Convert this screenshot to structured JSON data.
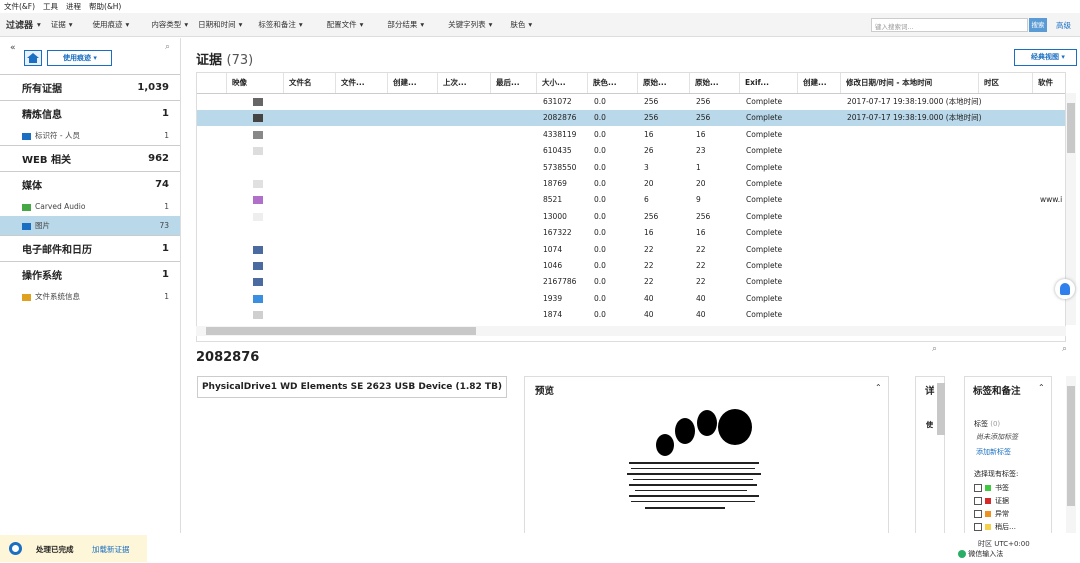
{
  "menubar": [
    "文件(&F)",
    "工具",
    "进程",
    "帮助(&H)"
  ],
  "filterbar": {
    "items": [
      "过滤器",
      "证据",
      "使用痕迹",
      "内容类型",
      "日期和时间",
      "标签和备注",
      "配置文件",
      "部分结果",
      "关键字列表",
      "肤色"
    ],
    "search_placeholder": "键入搜索词...",
    "search_button": "搜索",
    "advanced": "高级"
  },
  "sidebar": {
    "usage_dropdown": "使用痕迹",
    "categories": [
      {
        "label": "所有证据",
        "count": "1,039",
        "subs": []
      },
      {
        "label": "精炼信息",
        "count": "1",
        "subs": [
          {
            "label": "标识符 - 人员",
            "count": "1",
            "icon": "id-card-icon"
          }
        ]
      },
      {
        "label": "WEB 相关",
        "count": "962",
        "subs": []
      },
      {
        "label": "媒体",
        "count": "74",
        "subs": [
          {
            "label": "Carved Audio",
            "count": "1",
            "icon": "carved-audio-icon"
          },
          {
            "label": "图片",
            "count": "73",
            "icon": "picture-icon",
            "selected": true
          }
        ]
      },
      {
        "label": "电子邮件和日历",
        "count": "1",
        "subs": []
      },
      {
        "label": "操作系统",
        "count": "1",
        "subs": [
          {
            "label": "文件系统信息",
            "count": "1",
            "icon": "filesystem-icon"
          }
        ]
      }
    ]
  },
  "evidence": {
    "title": "证据",
    "count": "(73)",
    "view_button": "经典视图"
  },
  "grid": {
    "headers": [
      "",
      "映像",
      "文件名",
      "文件...",
      "创建...",
      "上次...",
      "最后...",
      "大小...",
      "肤色...",
      "原始...",
      "原始...",
      "Exif...",
      "创建...",
      "修改日期/时间 - 本地时间",
      "时区",
      "软件"
    ],
    "rows": [
      {
        "size": "631072",
        "skin": "0.0",
        "w": "256",
        "h": "256",
        "exif": "Complete",
        "modified": "2017-07-17 19:38:19.000  (本地时间)",
        "software": "",
        "thumb": "#666"
      },
      {
        "size": "2082876",
        "skin": "0.0",
        "w": "256",
        "h": "256",
        "exif": "Complete",
        "modified": "2017-07-17 19:38:19.000  (本地时间)",
        "software": "",
        "thumb": "#444",
        "selected": true
      },
      {
        "size": "4338119",
        "skin": "0.0",
        "w": "16",
        "h": "16",
        "exif": "Complete",
        "modified": "",
        "software": "",
        "thumb": "#888"
      },
      {
        "size": "610435",
        "skin": "0.0",
        "w": "26",
        "h": "23",
        "exif": "Complete",
        "modified": "",
        "software": "",
        "thumb": "#ddd"
      },
      {
        "size": "5738550",
        "skin": "0.0",
        "w": "3",
        "h": "1",
        "exif": "Complete",
        "modified": "",
        "software": "",
        "thumb": ""
      },
      {
        "size": "18769",
        "skin": "0.0",
        "w": "20",
        "h": "20",
        "exif": "Complete",
        "modified": "",
        "software": "",
        "thumb": "#e0e0e0"
      },
      {
        "size": "8521",
        "skin": "0.0",
        "w": "6",
        "h": "9",
        "exif": "Complete",
        "modified": "",
        "software": "www.i",
        "thumb": "#b06fc9"
      },
      {
        "size": "13000",
        "skin": "0.0",
        "w": "256",
        "h": "256",
        "exif": "Complete",
        "modified": "",
        "software": "",
        "thumb": "#eee"
      },
      {
        "size": "167322",
        "skin": "0.0",
        "w": "16",
        "h": "16",
        "exif": "Complete",
        "modified": "",
        "software": "",
        "thumb": ""
      },
      {
        "size": "1074",
        "skin": "0.0",
        "w": "22",
        "h": "22",
        "exif": "Complete",
        "modified": "",
        "software": "",
        "thumb": "#4a6aa0"
      },
      {
        "size": "1046",
        "skin": "0.0",
        "w": "22",
        "h": "22",
        "exif": "Complete",
        "modified": "",
        "software": "",
        "thumb": "#4a6aa0"
      },
      {
        "size": "2167786",
        "skin": "0.0",
        "w": "22",
        "h": "22",
        "exif": "Complete",
        "modified": "",
        "software": "",
        "thumb": "#4a6aa0"
      },
      {
        "size": "1939",
        "skin": "0.0",
        "w": "40",
        "h": "40",
        "exif": "Complete",
        "modified": "",
        "software": "",
        "thumb": "#3a8fe0"
      },
      {
        "size": "1874",
        "skin": "0.0",
        "w": "40",
        "h": "40",
        "exif": "Complete",
        "modified": "",
        "software": "",
        "thumb": "#cfcfcf"
      }
    ]
  },
  "detail": {
    "id": "2082876",
    "device": "PhysicalDrive1 WD Elements SE 2623 USB Device (1.82 TB)",
    "preview_title": "预览",
    "detail_title": "详",
    "detail_sub": "使",
    "tags_title": "标签和备注",
    "tags_label": "标签",
    "tags_count": "(0)",
    "no_tags": "尚未添加标签",
    "add_tag": "添加新标签",
    "select_existing": "选择现有标签:",
    "existing": [
      {
        "label": "书签",
        "color": "#3ec93e"
      },
      {
        "label": "证据",
        "color": "#d42a2a"
      },
      {
        "label": "异常",
        "color": "#f0901e"
      },
      {
        "label": "稍后…",
        "color": "#f5d04a"
      }
    ]
  },
  "status": {
    "text": "处理已完成",
    "load": "加载新证据",
    "tz": "时区 UTC+0:00",
    "ime": "微信输入法"
  },
  "colors": {
    "accent": "#1a6fc2",
    "selection": "#b9d8ea"
  }
}
